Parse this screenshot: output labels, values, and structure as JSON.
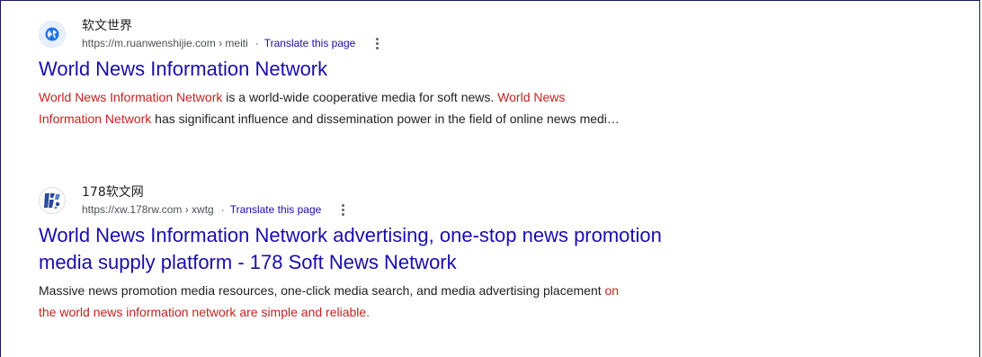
{
  "results": [
    {
      "site_name": "软文世界",
      "favicon": "globe-icon",
      "url": "https://m.ruanwenshijie.com › meiti",
      "separator": "·",
      "translate_label": "Translate this page",
      "title": "World News Information Network",
      "snippet": {
        "line1_hl1": "World News Information Network",
        "line1_text": " is a world-wide cooperative media for soft news. ",
        "line1_hl2": "World News",
        "line2_hl": "Information Network",
        "line2_text": " has significant influence and dissemination power in the field of online news medi…"
      }
    },
    {
      "site_name": "178软文网",
      "favicon": "178-logo-icon",
      "url": "https://xw.178rw.com › xwtg",
      "separator": "·",
      "translate_label": "Translate this page",
      "title_line1": "World News Information Network advertising, one-stop news promotion",
      "title_line2": "media supply platform - 178 Soft News Network",
      "snippet": {
        "line1_text": "Massive news promotion media resources, one-click media search, and media advertising placement ",
        "line1_hl": "on",
        "line2_hl": "the world news information network are simple and reliable."
      }
    }
  ],
  "colors": {
    "link": "#1a0dab",
    "highlight": "#c5221f",
    "text": "#202124",
    "url": "#4d5156"
  }
}
